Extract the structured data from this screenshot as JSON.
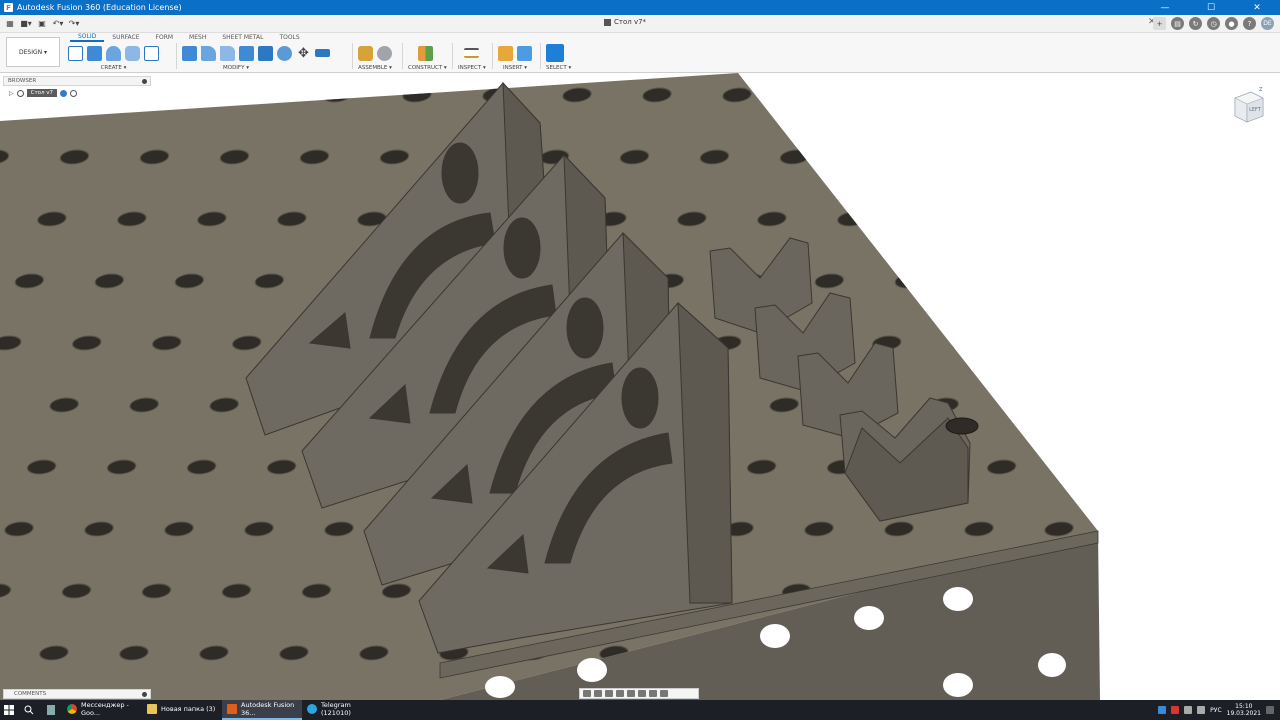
{
  "window": {
    "title": "Autodesk Fusion 360 (Education License)",
    "minimize_icon": "minimize-icon",
    "maximize_icon": "maximize-icon",
    "close_icon": "close-icon"
  },
  "document": {
    "tab_title": "Стол v7*"
  },
  "toolbar": {
    "workspace": "DESIGN",
    "tabs": [
      "SOLID",
      "SURFACE",
      "FORM",
      "MESH",
      "SHEET METAL",
      "TOOLS"
    ],
    "active_tab": "SOLID",
    "groups": [
      "CREATE",
      "MODIFY",
      "ASSEMBLE",
      "CONSTRUCT",
      "INSPECT",
      "INSERT",
      "SELECT"
    ]
  },
  "header_right": {
    "user_initials": "DE"
  },
  "browser": {
    "title": "BROWSER",
    "root_item": "Стол v7"
  },
  "comments": {
    "title": "COMMENTS"
  },
  "viewcube": {
    "face": "LEFT",
    "axis": "Z"
  },
  "taskbar": {
    "items": [
      {
        "label": "Мессенджер - Goo...",
        "icon": "chrome-icon",
        "active": false
      },
      {
        "label": "Новая папка (3)",
        "icon": "folder-icon",
        "active": false
      },
      {
        "label": "Autodesk Fusion 36...",
        "icon": "fusion-icon",
        "active": true
      },
      {
        "label": "Telegram (121010)",
        "icon": "telegram-icon",
        "active": false
      }
    ],
    "language": "РУС",
    "time": "15:10",
    "date": "19.03.2021"
  },
  "colors": {
    "title_bar": "#0a6fc7",
    "table_top": "#797366",
    "table_side": "#625e55",
    "part_face": "#77736a",
    "hole": "#2f2c27"
  }
}
